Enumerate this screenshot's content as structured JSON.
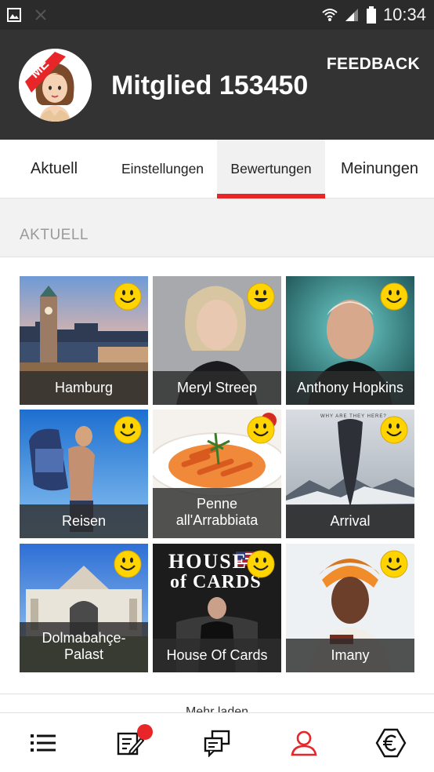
{
  "status_bar": {
    "time": "10:34"
  },
  "header": {
    "avatar_badge": "ME",
    "member_name": "Mitglied 153450",
    "feedback_label": "FEEDBACK"
  },
  "tabs": [
    {
      "label": "Aktuell",
      "active": false
    },
    {
      "label": "Einstellungen",
      "active": false
    },
    {
      "label": "Bewertungen",
      "active": true
    },
    {
      "label": "Meinungen",
      "active": false
    }
  ],
  "section": {
    "title": "AKTUELL"
  },
  "tiles": [
    {
      "label": "Hamburg"
    },
    {
      "label": "Meryl Streep"
    },
    {
      "label": "Anthony Hopkins"
    },
    {
      "label": "Reisen"
    },
    {
      "label": "Penne all'Arrabbiata"
    },
    {
      "label": "Arrival"
    },
    {
      "label": "Dolmabahçe-Palast"
    },
    {
      "label": "House Of Cards"
    },
    {
      "label": "Imany"
    }
  ],
  "tile_texts": {
    "house_of_cards_logo_1": "HOUSE",
    "house_of_cards_logo_2": "of CARDS",
    "arrival_tagline": "WHY ARE THEY HERE?"
  },
  "more_link": "Mehr laden",
  "bottom_nav": [
    {
      "icon": "list-icon"
    },
    {
      "icon": "edit-note-icon",
      "badge": true
    },
    {
      "icon": "chat-icon"
    },
    {
      "icon": "profile-icon",
      "active": true
    },
    {
      "icon": "euro-icon"
    }
  ],
  "colors": {
    "accent": "#e8262a",
    "header": "#333333",
    "smiley": "#ffd400"
  }
}
